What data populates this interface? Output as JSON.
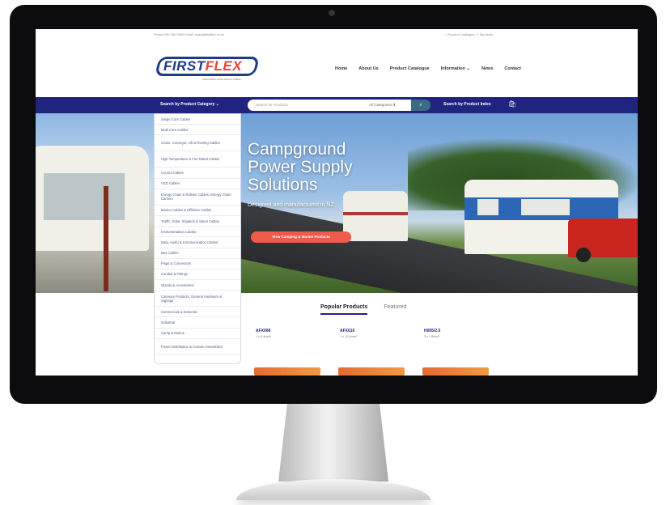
{
  "topbar": {
    "contact": "Phone 250 254 0000    Email: sales@firstflex.co.nz",
    "account": "⌂ Product Catalogue    ☺ My Items"
  },
  "brand": {
    "name_first": "FIRST",
    "name_flex": "FLEX",
    "tagline": "INDUSTRIAL ELECTRICAL CABLE",
    "colors": {
      "primary": "#20247e",
      "accent": "#e8442f"
    }
  },
  "nav": {
    "items": [
      "Home",
      "About Us",
      "Product Catalogue",
      "Information ⌄",
      "News",
      "Contact"
    ]
  },
  "search": {
    "category_button": "Search by Product Category",
    "placeholder": "Search for Products",
    "category_select": "All Categories ⬍",
    "index_link": "Search by Product Index"
  },
  "categories": [
    "Single Core Cables",
    "Multi Core Cables",
    "Crane, Conveyor, Lift & Reeling Cables",
    "High Temperature & Fire Rated Cables",
    "Control Cables",
    "VSD Cables",
    "Energy Chain & Robotic Cables, Energy Chain Carriers",
    "Marine Cables & Offshore Cables",
    "Traffic, Solar, Irrigation & Spiral Cables",
    "Instrumentation Cables",
    "Data, Audio & Communication Cables",
    "Bus Cables",
    "Plugs & Connectors",
    "Conduit & Fittings",
    "Glands & Accessories",
    "Catenary Products, General Hardware & Signage",
    "Commercial & Domestic",
    "Industrial",
    "Camp & Marine",
    "Power Distribution & Custom Assemblies"
  ],
  "hero": {
    "title": "Campground Power Supply Solutions",
    "subtitle": "Designed and manufactured in NZ",
    "cta": "View Camping & Marine Products"
  },
  "tabs": {
    "active": "Popular Products",
    "other": "Featured"
  },
  "products": [
    {
      "code": "AFX008",
      "size": "1 x 0.4mm²"
    },
    {
      "code": "AFX010",
      "size": "1 x 10.0mm²"
    },
    {
      "code": "H005/2.5",
      "size": "3 x 2.5mm²"
    }
  ]
}
